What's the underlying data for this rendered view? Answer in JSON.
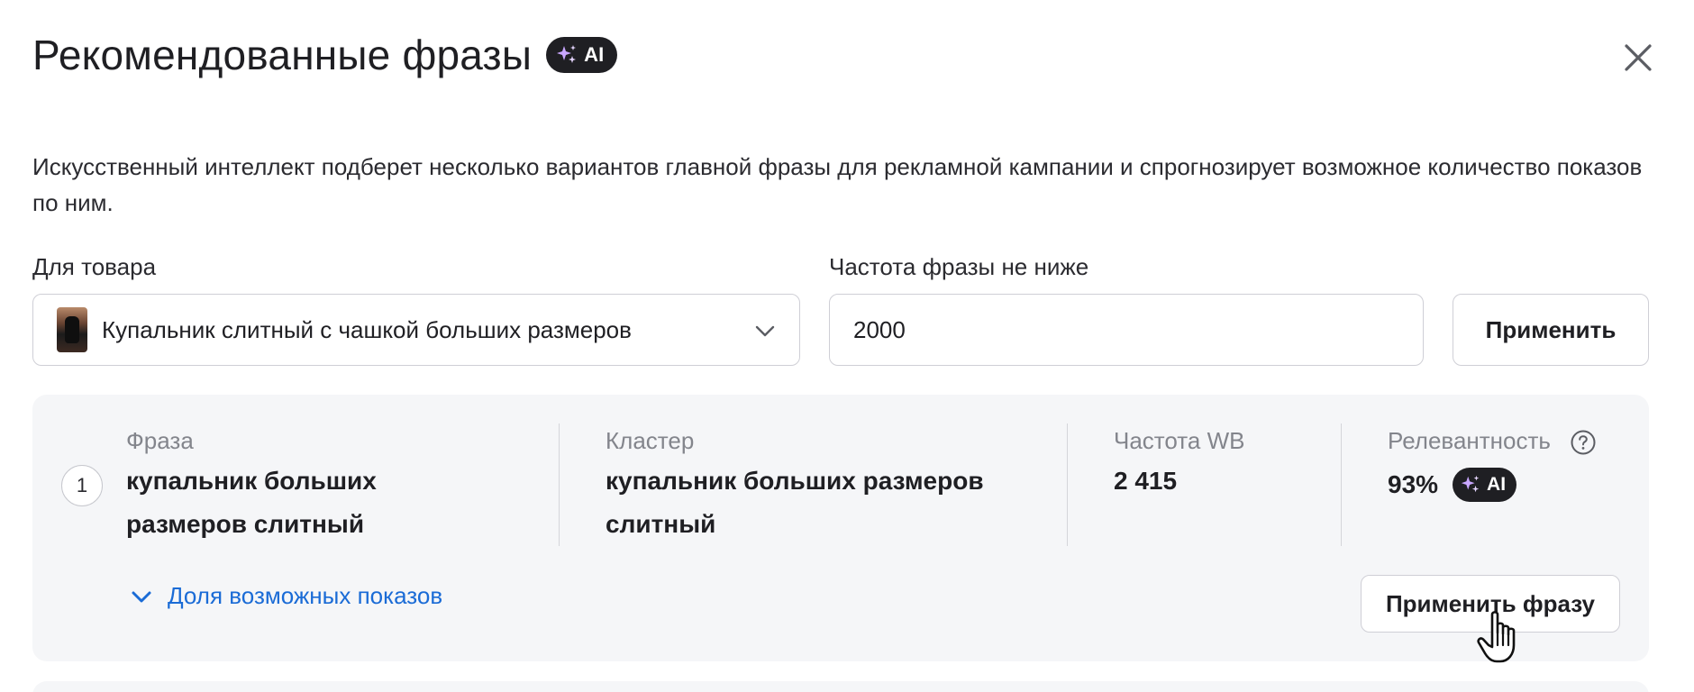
{
  "modal": {
    "title": "Рекомендованные фразы",
    "ai_badge": "AI",
    "description": "Искусственный интеллект подберет несколько вариантов главной фразы для рекламной кампании и спрогнозирует возможное количество показов по ним."
  },
  "form": {
    "product_label": "Для товара",
    "product_value": "Купальник слитный с чашкой больших размеров",
    "frequency_label": "Частота фразы не ниже",
    "frequency_value": "2000",
    "apply_label": "Применить"
  },
  "results": [
    {
      "index": "1",
      "phrase_header": "Фраза",
      "phrase_line1": "купальник больших",
      "phrase_line2": "размеров слитный",
      "cluster_header": "Кластер",
      "cluster_line1": "купальник больших размеров",
      "cluster_line2": "слитный",
      "frequency_header": "Частота WB",
      "frequency_value": "2 415",
      "relevance_header": "Релевантность",
      "relevance_value": "93%",
      "share_link": "Доля возможных показов",
      "apply_phrase_label": "Применить фразу"
    }
  ],
  "icons": {
    "close": "close-icon",
    "sparkles": "sparkles-icon",
    "chevron": "chevron-down-icon",
    "help": "help-circle-icon",
    "cursor": "hand-pointer-icon"
  },
  "colors": {
    "link": "#1a6bd6",
    "badge_bg": "#1f1f23",
    "sparkle": "#c9a7ff",
    "card_bg": "#f5f6f8"
  }
}
